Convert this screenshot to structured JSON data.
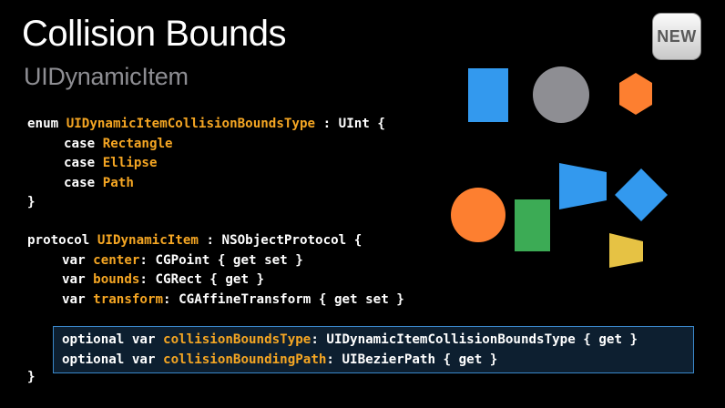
{
  "slide": {
    "title": "Collision Bounds",
    "subtitle": "UIDynamicItem",
    "badge": "NEW"
  },
  "enum_block": {
    "line1": {
      "kw_enum": "enum",
      "name": "UIDynamicItemCollisionBoundsType",
      "rest": " : UInt {"
    },
    "cases": [
      {
        "kw": "case",
        "name": "Rectangle"
      },
      {
        "kw": "case",
        "name": "Ellipse"
      },
      {
        "kw": "case",
        "name": "Path"
      }
    ],
    "close": "}"
  },
  "protocol_block": {
    "line1": {
      "kw": "protocol",
      "name": "UIDynamicItem",
      "rest": " : NSObjectProtocol {"
    },
    "vars": [
      {
        "kw": "var",
        "name": "center",
        "rest": ": CGPoint { get set }"
      },
      {
        "kw": "var",
        "name": "bounds",
        "rest": ": CGRect { get }"
      },
      {
        "kw": "var",
        "name": "transform",
        "rest": ": CGAffineTransform { get set }"
      }
    ],
    "optionals": [
      {
        "kw": "optional var",
        "name": "collisionBoundsType",
        "rest": ": UIDynamicItemCollisionBoundsType { get }"
      },
      {
        "kw": "optional var",
        "name": "collisionBoundingPath",
        "rest": ": UIBezierPath { get }"
      }
    ],
    "close": "}"
  },
  "colors": {
    "background": "#000000",
    "title": "#ffffff",
    "subtitle": "#8e8e93",
    "identifier": "#f5a623",
    "keyword": "#ffffff",
    "highlight_border": "#3a87c9",
    "shape_blue": "#3399ee",
    "shape_gray": "#8e8e93",
    "shape_orange": "#fd7f30",
    "shape_green": "#3cab55",
    "shape_yellow": "#e6c244"
  },
  "shapes": [
    {
      "name": "blue-rectangle",
      "color": "blue"
    },
    {
      "name": "gray-circle",
      "color": "gray"
    },
    {
      "name": "orange-hexagon",
      "color": "orange"
    },
    {
      "name": "blue-trapezoid",
      "color": "blue"
    },
    {
      "name": "blue-diamond",
      "color": "blue"
    },
    {
      "name": "orange-circle",
      "color": "orange"
    },
    {
      "name": "green-rectangle",
      "color": "green"
    },
    {
      "name": "yellow-trapezoid",
      "color": "yellow"
    }
  ]
}
